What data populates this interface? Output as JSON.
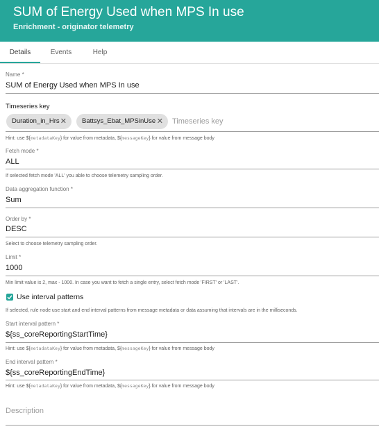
{
  "header": {
    "title": "SUM of Energy Used when MPS In use",
    "subtitle": "Enrichment - originator telemetry"
  },
  "tabs": [
    "Details",
    "Events",
    "Help"
  ],
  "form": {
    "name_label": "Name *",
    "name_value": "SUM of Energy Used when MPS In use",
    "ts_key_label": "Timeseries key",
    "ts_chips": [
      "Duration_in_Hrs",
      "Battsys_Ebat_MPSinUse"
    ],
    "ts_placeholder": "Timeseries key",
    "ts_hint_pre": "Hint: use ${",
    "ts_hint_meta": "metadataKey",
    "ts_hint_mid": "} for value from metadata, ${",
    "ts_hint_msg": "messageKey",
    "ts_hint_post": "} for value from message body",
    "fetch_label": "Fetch mode *",
    "fetch_value": "ALL",
    "fetch_hint": "If selected fetch mode 'ALL' you able to choose telemetry sampling order.",
    "agg_label": "Data aggregation function *",
    "agg_value": "Sum",
    "order_label": "Order by *",
    "order_value": "DESC",
    "order_hint": "Select to choose telemetry sampling order.",
    "limit_label": "Limit *",
    "limit_value": "1000",
    "limit_hint": "Min limit value is 2, max - 1000. In case you want to fetch a single entry, select fetch mode 'FIRST' or 'LAST'.",
    "interval_checked": true,
    "interval_label": "Use interval patterns",
    "interval_hint": "If selected, rule node use start and end interval patterns from message metadata or data assuming that intervals are in the milliseconds.",
    "start_label": "Start interval pattern *",
    "start_value": "${ss_coreReportingStartTime}",
    "end_label": "End interval pattern *",
    "end_value": "${ss_coreReportingEndTime}",
    "description_placeholder": "Description"
  },
  "colors": {
    "accent": "#26a69a"
  }
}
